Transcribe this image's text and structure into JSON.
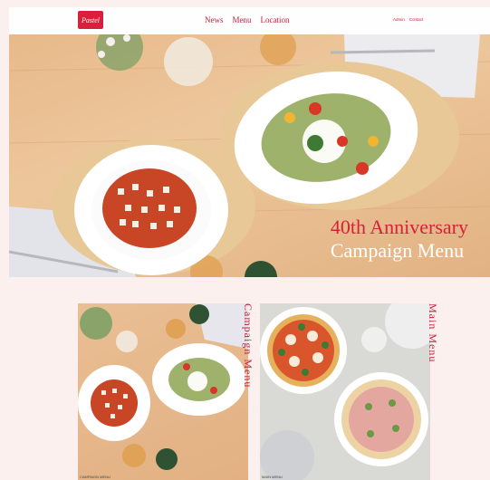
{
  "header": {
    "logo_text": "Pastel",
    "nav": [
      "News",
      "Menu",
      "Location"
    ],
    "util": [
      "Admin",
      "Contact"
    ]
  },
  "hero": {
    "title_line1": "40th Anniversary",
    "title_line2": "Campaign Menu"
  },
  "cards": [
    {
      "label": "Campaign Menu",
      "caption": "CAMPAIGN MENU"
    },
    {
      "label": "Main Menu",
      "caption": "MAIN MENU"
    }
  ],
  "colors": {
    "accent": "#c4203a",
    "background": "#fbf0ee"
  }
}
